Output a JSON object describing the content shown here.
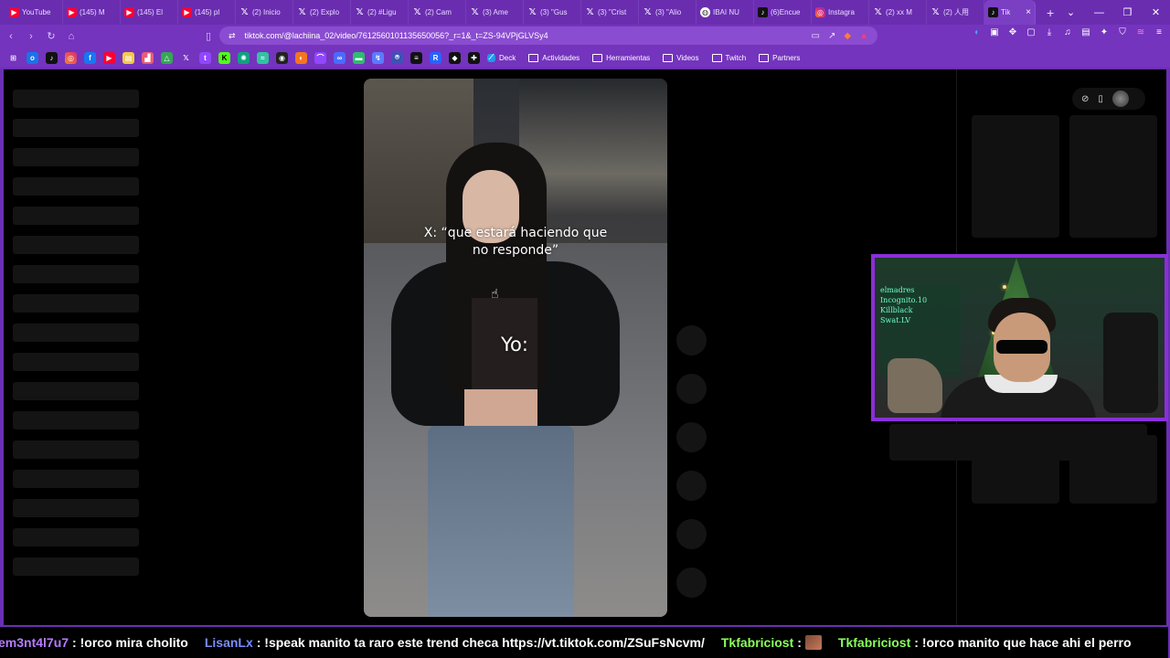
{
  "browser": {
    "tabs": [
      {
        "icon": "youtube-icon",
        "label": "YouTube"
      },
      {
        "icon": "youtube-icon",
        "label": "(145) M"
      },
      {
        "icon": "youtube-icon",
        "label": "(145) El"
      },
      {
        "icon": "youtube-icon",
        "label": "(145) pl"
      },
      {
        "icon": "x-icon",
        "label": "(2) Inicio"
      },
      {
        "icon": "x-icon",
        "label": "(2) Explo"
      },
      {
        "icon": "x-icon",
        "label": "(2) #Ligu"
      },
      {
        "icon": "x-icon",
        "label": "(2) Cam"
      },
      {
        "icon": "x-icon",
        "label": "(3) Ame"
      },
      {
        "icon": "x-icon",
        "label": "(3) \"Gus"
      },
      {
        "icon": "x-icon",
        "label": "(3) \"Crist"
      },
      {
        "icon": "x-icon",
        "label": "(3) \"Alio"
      },
      {
        "icon": "globe-icon",
        "label": "IBAI NU"
      },
      {
        "icon": "tiktok-icon",
        "label": "(6)Encue"
      },
      {
        "icon": "instagram-icon",
        "label": "Instagra"
      },
      {
        "icon": "x-icon",
        "label": "(2) xx M"
      },
      {
        "icon": "x-icon",
        "label": "(2) 人用"
      },
      {
        "icon": "tiktok-icon",
        "label": "Tik",
        "active": true
      }
    ],
    "url": "tiktok.com/@lachiina_02/video/7612560101135650056?_r=1&_t=ZS-94VPjGLVSy4",
    "bookmarks": {
      "folders": [
        "Deck",
        "Actividades",
        "Herramientas",
        "Videos",
        "Twitch",
        "Partners"
      ]
    },
    "accent": "#6b2fb3"
  },
  "video": {
    "caption_top": "X: “que estará haciendo que no responde”",
    "caption_yo": "Yo:"
  },
  "webcam": {
    "sign_lines": [
      "elmadres",
      "Incognito.10",
      "Killblack",
      "Swat.LV"
    ]
  },
  "chat": {
    "messages": [
      {
        "user": "em3nt4l7u7",
        "user_color": "#b57cff",
        "text": ": !orco mira cholito"
      },
      {
        "user": "LisanLx",
        "user_color": "#7a8cff",
        "text": ": !speak manito ta raro este trend checa https://vt.tiktok.com/ZSuFsNcvm/"
      },
      {
        "user": "Tkfabriciost",
        "user_color": "#8aff5a",
        "text": " :",
        "emote": true
      },
      {
        "user": "Tkfabriciost",
        "user_color": "#8aff5a",
        "text": " : !orco manito que hace ahi el perro"
      }
    ]
  }
}
